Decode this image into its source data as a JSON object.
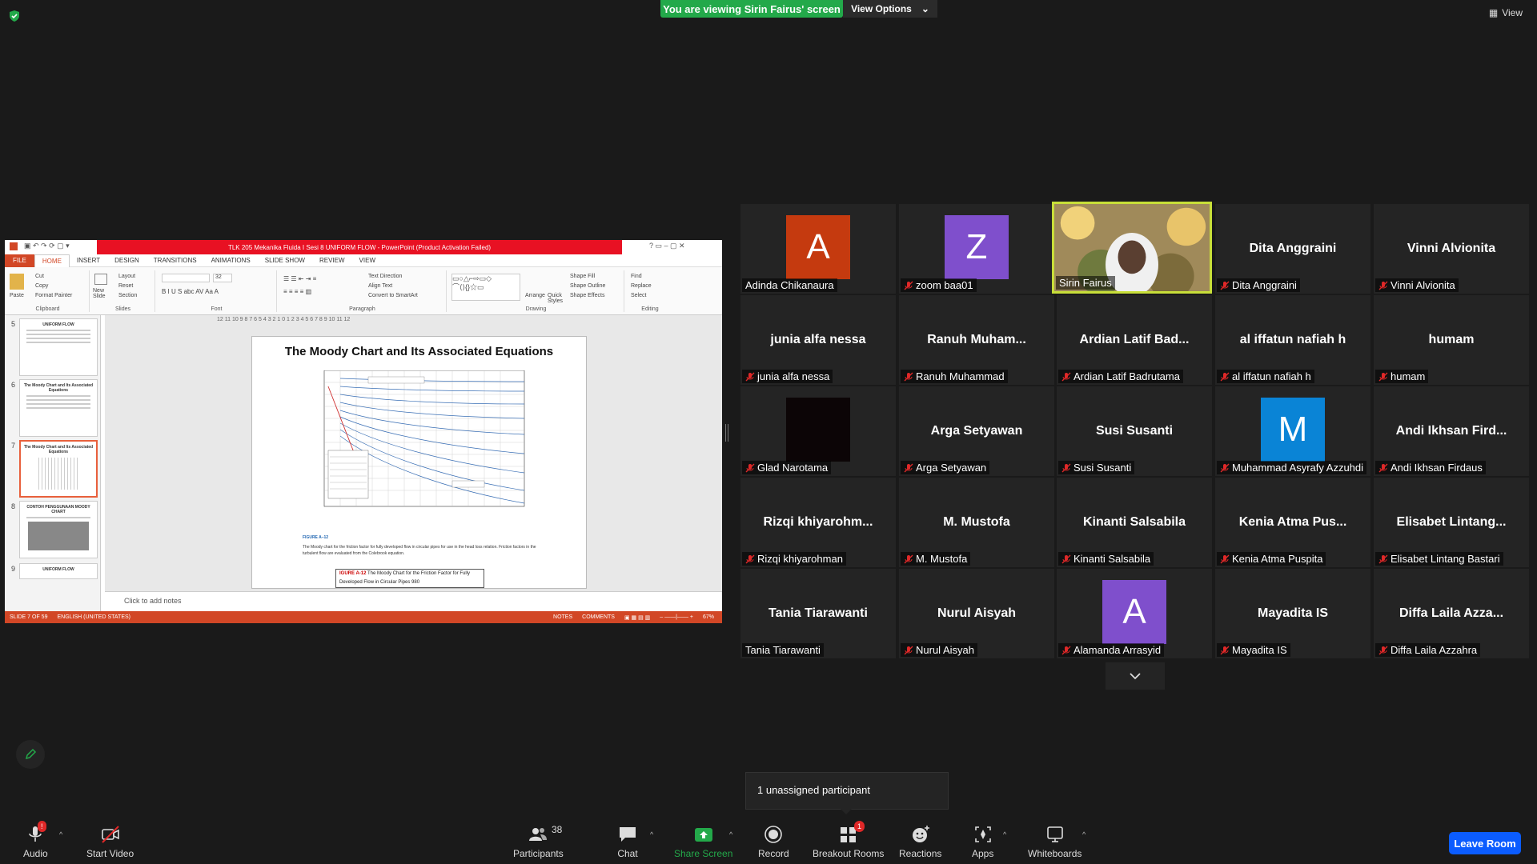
{
  "banner": {
    "viewing_text": "You are viewing Sirin Fairus' screen",
    "view_options": "View Options"
  },
  "view_btn": "View",
  "shared_screen": {
    "window_title": "TLK 205 Mekanika Fluida I Sesi 8  UNIFORM FLOW - PowerPoint (Product Activation Failed)",
    "menu": [
      "FILE",
      "HOME",
      "INSERT",
      "DESIGN",
      "TRANSITIONS",
      "ANIMATIONS",
      "SLIDE SHOW",
      "REVIEW",
      "VIEW"
    ],
    "ribbon": {
      "clipboard": {
        "paste": "Paste",
        "cut": "Cut",
        "copy": "Copy",
        "format_painter": "Format Painter",
        "label": "Clipboard"
      },
      "slides": {
        "new_slide": "New Slide",
        "layout": "Layout",
        "reset": "Reset",
        "section": "Section",
        "label": "Slides"
      },
      "font": {
        "size": "32",
        "label": "Font"
      },
      "paragraph": {
        "text_direction": "Text Direction",
        "align_text": "Align Text",
        "convert_smartart": "Convert to SmartArt",
        "label": "Paragraph"
      },
      "drawing": {
        "arrange": "Arrange",
        "quick_styles": "Quick Styles",
        "shape_fill": "Shape Fill",
        "shape_outline": "Shape Outline",
        "shape_effects": "Shape Effects",
        "label": "Drawing"
      },
      "editing": {
        "find": "Find",
        "replace": "Replace",
        "select": "Select",
        "label": "Editing"
      }
    },
    "thumbs": [
      {
        "num": "5",
        "title": "UNIFORM FLOW"
      },
      {
        "num": "6",
        "title": "The Moody Chart and Its Associated Equations"
      },
      {
        "num": "7",
        "title": "The Moody Chart and Its Associated Equations"
      },
      {
        "num": "8",
        "title": "CONTOH PENGGUNAAN MOODY CHART"
      },
      {
        "num": "9",
        "title": "UNIFORM FLOW"
      }
    ],
    "ruler": "12 11 10 9 8 7 6 5 4 3 2 1 0 1 2 3 4 5 6 7 8 9 10 11 12",
    "slide": {
      "title": "The Moody Chart and Its Associated Equations",
      "figure_label": "FIGURE A–12",
      "caption": "The Moody chart for the friction factor for fully developed flow in circular pipes for use in the head loss relation. Friction factors in the turbulent flow are evaluated from the Colebrook equation.",
      "box_line1_red": "IGURE A-12",
      "box_line1": " The Moody Chart for the Friction Factor for Fully",
      "box_line2": "Developed Flow in Circular Pipes 980"
    },
    "notes": "Click to add notes",
    "status": {
      "slide": "SLIDE 7 OF 59",
      "lang": "ENGLISH (UNITED STATES)",
      "notes": "NOTES",
      "comments": "COMMENTS",
      "zoom": "67%"
    }
  },
  "participants": [
    {
      "label": "Adinda Chikanaura",
      "avatar": "A",
      "color": "#c53a0f",
      "muted": false
    },
    {
      "label": "zoom baa01",
      "avatar": "Z",
      "color": "#7f4fcc",
      "muted": true
    },
    {
      "label": "Sirin Fairus",
      "video": true,
      "muted": false,
      "speaking": true
    },
    {
      "center": "Dita Anggraini",
      "label": "Dita Anggraini",
      "muted": true
    },
    {
      "center": "Vinni Alvionita",
      "label": "Vinni Alvionita",
      "muted": true
    },
    {
      "center": "junia alfa nessa",
      "label": "junia alfa nessa",
      "muted": true
    },
    {
      "center": "Ranuh  Muham...",
      "label": "Ranuh Muhammad",
      "muted": true
    },
    {
      "center": "Ardian  Latif  Bad...",
      "label": "Ardian Latif Badrutama",
      "muted": true
    },
    {
      "center": "al iffatun nafiah h",
      "label": "al iffatun nafiah h",
      "muted": true
    },
    {
      "center": "humam",
      "label": "humam",
      "muted": true
    },
    {
      "label": "Glad Narotama",
      "dark": true,
      "muted": true
    },
    {
      "center": "Arga Setyawan",
      "label": "Arga Setyawan",
      "muted": true
    },
    {
      "center": "Susi Susanti",
      "label": "Susi Susanti",
      "muted": true
    },
    {
      "label": "Muhammad Asyrafy Azzuhdi",
      "avatar": "M",
      "color": "#0a84d6",
      "muted": true
    },
    {
      "center": "Andi Ikhsan Fird...",
      "label": "Andi Ikhsan Firdaus",
      "muted": true
    },
    {
      "center": "Rizqi  khiyarohm...",
      "label": "Rizqi khiyarohman",
      "muted": true
    },
    {
      "center": "M. Mustofa",
      "label": "M. Mustofa",
      "muted": true
    },
    {
      "center": "Kinanti Salsabila",
      "label": "Kinanti Salsabila",
      "muted": true
    },
    {
      "center": "Kenia Atma Pus...",
      "label": "Kenia Atma Puspita",
      "muted": true
    },
    {
      "center": "Elisabet  Lintang...",
      "label": "Elisabet Lintang Bastari",
      "muted": true
    },
    {
      "center": "Tania Tiarawanti",
      "label": "Tania Tiarawanti",
      "muted": false
    },
    {
      "center": "Nurul Aisyah",
      "label": "Nurul Aisyah",
      "muted": true
    },
    {
      "label": "Alamanda Arrasyid",
      "avatar": "A",
      "color": "#7f4fcc",
      "muted": true
    },
    {
      "center": "Mayadita IS",
      "label": "Mayadita IS",
      "muted": true
    },
    {
      "center": "Diffa Laila Azza...",
      "label": "Diffa Laila Azzahra",
      "muted": true
    }
  ],
  "unassigned": "1 unassigned participant",
  "toolbar": {
    "audio": "Audio",
    "audio_badge": "!",
    "video": "Start Video",
    "participants": "Participants",
    "participants_count": "38",
    "chat": "Chat",
    "share": "Share Screen",
    "record": "Record",
    "breakout": "Breakout Rooms",
    "breakout_badge": "1",
    "reactions": "Reactions",
    "apps": "Apps",
    "whiteboards": "Whiteboards",
    "leave": "Leave Room"
  },
  "colors": {
    "share_green": "#23a94a",
    "leave_blue": "#0b5cff",
    "ppt_red": "#d24726",
    "speaking": "#c8df39"
  }
}
